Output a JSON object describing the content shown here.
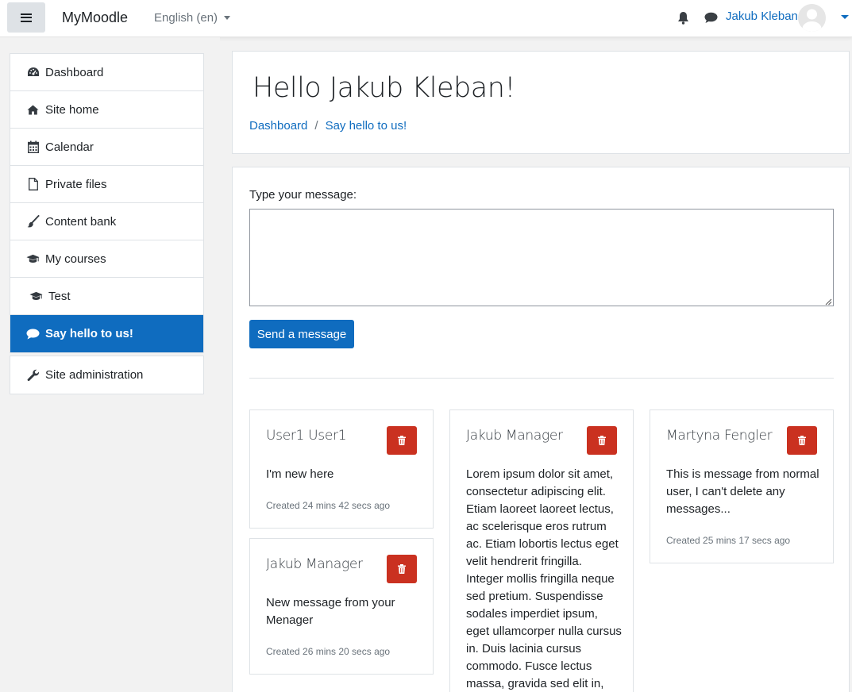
{
  "navbar": {
    "brand": "MyMoodle",
    "language": "English (en)",
    "user_name": "Jakub Kleban",
    "icons": [
      "menu-icon",
      "bell-icon",
      "chat-icon",
      "avatar-icon",
      "chevron-down-icon"
    ]
  },
  "sidebar": {
    "items": [
      {
        "label": "Dashboard",
        "icon": "dashboard-icon"
      },
      {
        "label": "Site home",
        "icon": "home-icon"
      },
      {
        "label": "Calendar",
        "icon": "calendar-icon"
      },
      {
        "label": "Private files",
        "icon": "file-icon"
      },
      {
        "label": "Content bank",
        "icon": "paintbrush-icon"
      },
      {
        "label": "My courses",
        "icon": "graduation-cap-icon"
      },
      {
        "label": "Test",
        "icon": "graduation-cap-icon"
      },
      {
        "label": "Say hello to us!",
        "icon": "chat-icon",
        "active": true
      }
    ],
    "admin": {
      "label": "Site administration",
      "icon": "wrench-icon"
    }
  },
  "header": {
    "title": "Hello Jakub Kleban!",
    "breadcrumb": [
      "Dashboard",
      "Say hello to us!"
    ],
    "breadcrumb_separator": "/"
  },
  "form": {
    "label": "Type your message:",
    "message_value": "",
    "send_label": "Send a message"
  },
  "messages": [
    {
      "author": "User1 User1",
      "text": "I'm new here",
      "created": "Created 24 mins 42 secs ago"
    },
    {
      "author": "Jakub Manager",
      "text": "New message from your Menager",
      "created": "Created 26 mins 20 secs ago"
    },
    {
      "author": "Jakub Manager",
      "text": "Lorem ipsum dolor sit amet, consectetur adipiscing elit. Etiam laoreet laoreet lectus, ac scelerisque eros rutrum ac. Etiam lobortis lectus eget velit hendrerit fringilla. Integer mollis fringilla neque sed pretium. Suspendisse sodales imperdiet ipsum, eget ullamcorper nulla cursus in. Duis lacinia cursus commodo. Fusce lectus massa, gravida sed elit in,",
      "created": ""
    },
    {
      "author": "Martyna Fengler",
      "text": "This is message from normal user, I can't delete any messages...",
      "created": "Created 25 mins 17 secs ago"
    }
  ],
  "colors": {
    "primary": "#0f6cbf",
    "danger": "#ca3120",
    "page_bg": "#f2f2f2"
  }
}
